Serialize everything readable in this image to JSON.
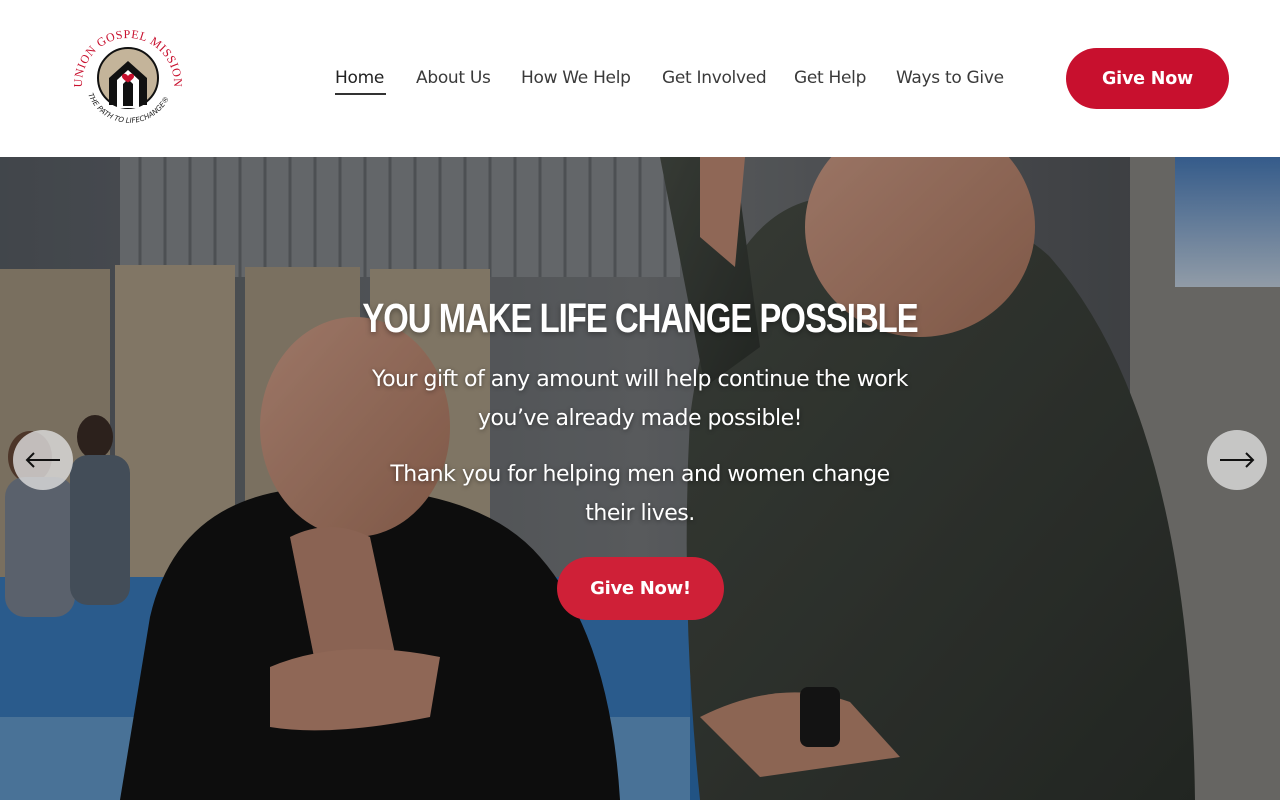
{
  "header": {
    "logo_text_top": "UNION GOSPEL MISSION",
    "logo_text_bottom": "THE PATH TO LIFECHANGE",
    "nav": [
      {
        "label": "Home",
        "active": true
      },
      {
        "label": "About Us"
      },
      {
        "label": "How We Help"
      },
      {
        "label": "Get Involved"
      },
      {
        "label": "Get Help"
      },
      {
        "label": "Ways to Give"
      }
    ],
    "cta_label": "Give Now"
  },
  "hero": {
    "title": "You Make Life Change Possible",
    "paragraph1_line1": "Your gift of any amount will help continue the work",
    "paragraph1_line2": "you’ve already made possible!",
    "paragraph2_line1": "Thank you for helping men and women change",
    "paragraph2_line2": "their lives.",
    "cta_label": "Give Now!"
  },
  "slider": {
    "prev_icon": "arrow-left-icon",
    "next_icon": "arrow-right-icon"
  },
  "colors": {
    "brand_red": "#c8102e",
    "hero_cta_red": "#cf2037",
    "nav_text": "#3a3a3a"
  }
}
